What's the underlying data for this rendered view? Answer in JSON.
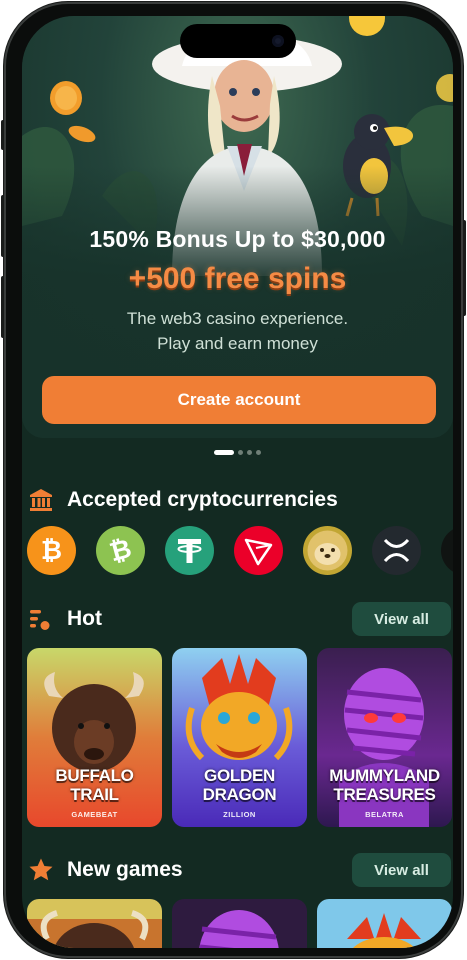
{
  "hero": {
    "title": "150% Bonus Up to $30,000",
    "spins": "+500 free spins",
    "subtitle_line1": "The web3 casino experience.",
    "subtitle_line2": "Play and earn money",
    "cta_label": "Create account",
    "carousel_total": 4,
    "carousel_active": 1
  },
  "crypto": {
    "title": "Accepted cryptocurrencies",
    "icon": "bank-icon",
    "coins": [
      {
        "name": "bitcoin",
        "color": "#f7931a"
      },
      {
        "name": "bitcoin-cash",
        "color": "#8dc351"
      },
      {
        "name": "tether",
        "color": "#26a17b"
      },
      {
        "name": "tron",
        "color": "#eb0029"
      },
      {
        "name": "dogecoin",
        "color": "#c2a633"
      },
      {
        "name": "xrp",
        "color": "#23292f"
      }
    ]
  },
  "hot": {
    "title": "Hot",
    "icon": "list-fire-icon",
    "view_all_label": "View all",
    "games": [
      {
        "name_line1": "BUFFALO",
        "name_line2": "TRAIL",
        "provider": "GAMEBEAT"
      },
      {
        "name_line1": "GOLDEN",
        "name_line2": "DRAGON",
        "provider": "ZILLION"
      },
      {
        "name_line1": "MUMMYLAND",
        "name_line2": "TREASURES",
        "provider": "BELATRA"
      }
    ]
  },
  "new_games": {
    "title": "New games",
    "icon": "star-icon",
    "view_all_label": "View all"
  },
  "colors": {
    "background": "#132a22",
    "accent": "#f07e35",
    "view_all_bg": "#1f4c3e"
  }
}
